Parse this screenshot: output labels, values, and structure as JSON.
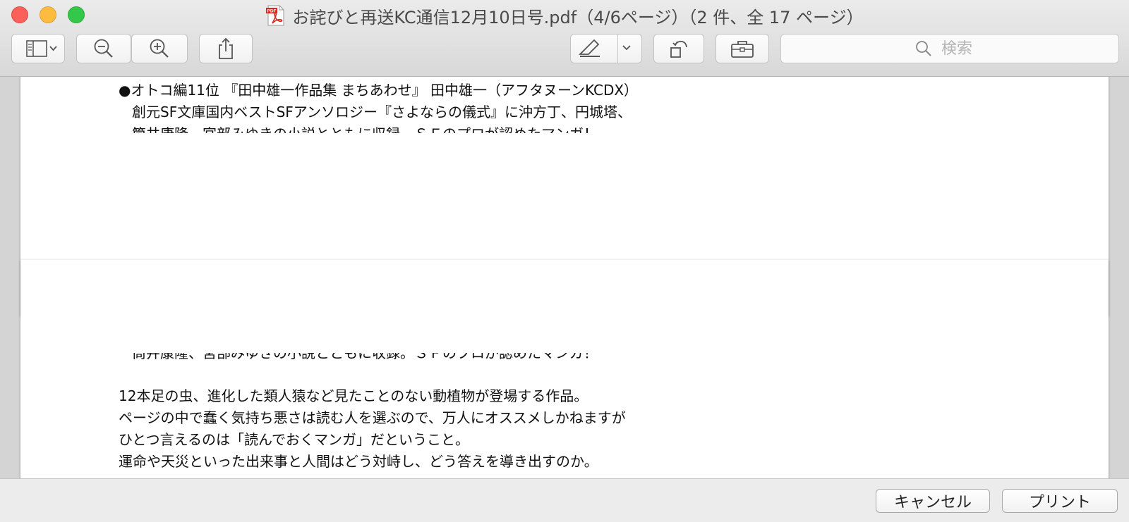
{
  "window": {
    "title": "お詫びと再送KC通信12月10日号.pdf（4/6ページ）（2 件、全 17 ページ）",
    "pdf_badge": "PDF"
  },
  "toolbar": {
    "items": [
      {
        "name": "sidebar-toggle",
        "icon": "sidebar-icon"
      },
      {
        "name": "zoom-out",
        "icon": "zoom-out-icon"
      },
      {
        "name": "zoom-in",
        "icon": "zoom-in-icon"
      },
      {
        "name": "share",
        "icon": "share-icon"
      },
      {
        "name": "markup",
        "icon": "pen-icon"
      },
      {
        "name": "rotate",
        "icon": "rotate-icon"
      },
      {
        "name": "toolbox",
        "icon": "toolbox-icon"
      }
    ],
    "search_placeholder": "検索"
  },
  "document": {
    "page_top": {
      "lines": [
        "●オトコ編11位 『田中雄一作品集 まちあわせ』 田中雄一（アフタヌーンKCDX）",
        "創元SF文庫国内ベストSFアンソロジー『さよならの儀式』に沖方丁、円城塔、",
        "筒井康隆、宮部みゆきの小説とともに収録。ＳＦのプロが認めたマンガ！"
      ]
    },
    "page_bottom": {
      "lines": [
        "筒井康隆、宮部みゆきの小説とともに収録。ＳＦのプロが認めたマンガ！",
        "12本足の虫、進化した類人猿など見たことのない動植物が登場する作品。",
        "ページの中で蠢く気持ち悪さは読む人を選ぶので、万人にオススメしかねますが",
        "ひとつ言えるのは「読んでおくマンガ」だということ。",
        "運命や天災といった出来事と人間はどう対峙し、どう答えを導き出すのか。"
      ]
    }
  },
  "footer": {
    "cancel_label": "キャンセル",
    "print_label": "プリント"
  },
  "colors": {
    "close": "#fc605b",
    "minimize": "#fdbc40",
    "maximize": "#34c84a",
    "pdf_red": "#d9261c"
  }
}
